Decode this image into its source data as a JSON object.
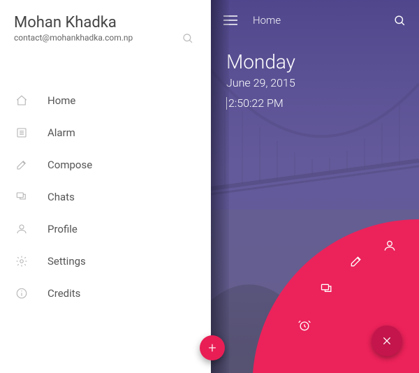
{
  "profile": {
    "name": "Mohan Khadka",
    "email": "contact@mohankhadka.com.np"
  },
  "nav": {
    "items": [
      {
        "label": "Home"
      },
      {
        "label": "Alarm"
      },
      {
        "label": "Compose"
      },
      {
        "label": "Chats"
      },
      {
        "label": "Profile"
      },
      {
        "label": "Settings"
      },
      {
        "label": "Credits"
      }
    ]
  },
  "header": {
    "title": "Home"
  },
  "hero": {
    "day": "Monday",
    "date": "June 29, 2015",
    "time": "2:50:22 PM"
  },
  "colors": {
    "accent": "#ec225a",
    "accent_dark": "#c4154c",
    "purple": "#5f5694"
  },
  "fab": {
    "add_label": "+"
  }
}
